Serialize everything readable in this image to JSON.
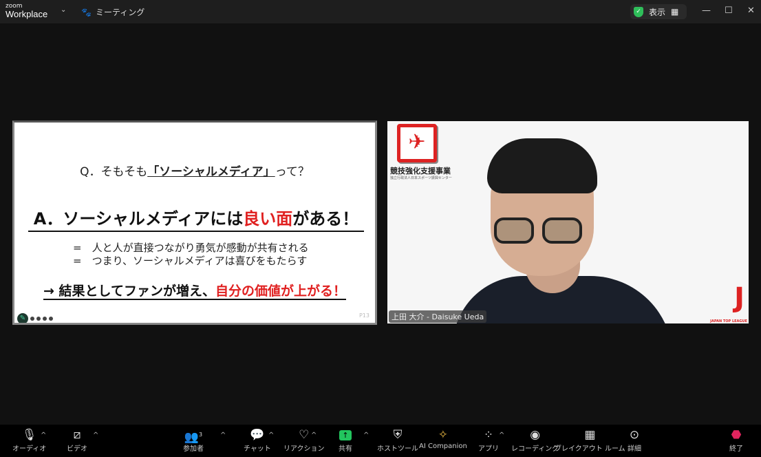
{
  "titlebar": {
    "brand_small": "zoom",
    "brand": "Workplace",
    "meeting": "ミーティング",
    "view": "表示"
  },
  "slide": {
    "question": "Q．そもそも",
    "question_u": "「ソーシャルメディア」",
    "question_end": "って？",
    "answer_a": "A．ソーシャルメディアには",
    "answer_red": "良い面",
    "answer_b": "がある！",
    "bullet1": "=　人と人が直接つながり勇気が感動が共有される",
    "bullet2": "=　つまり、ソーシャルメディアは喜びをもたらす",
    "result_a": "→ 結果としてファンが増え、",
    "result_red": "自分の価値が上がる！",
    "page": "P13"
  },
  "video": {
    "org": "競技強化支援事業",
    "org_sub": "独立行政法人日本スポーツ振興センター",
    "league": "JAPAN TOP LEAGUE",
    "participant": "上田 大介 - Daisuke Ueda"
  },
  "toolbar": {
    "audio": "オーディオ",
    "video": "ビデオ",
    "participants": "参加者",
    "participant_count": "3",
    "chat": "チャット",
    "reactions": "リアクション",
    "share": "共有",
    "host_tools": "ホストツール",
    "ai": "AI Companion",
    "apps": "アプリ",
    "record": "レコーディング",
    "breakout": "ブレイクアウト ルーム",
    "more": "詳細",
    "end": "終了"
  },
  "colors": {
    "accent_red": "#e02020",
    "share_green": "#22c55e",
    "end_red": "#e0245e"
  }
}
